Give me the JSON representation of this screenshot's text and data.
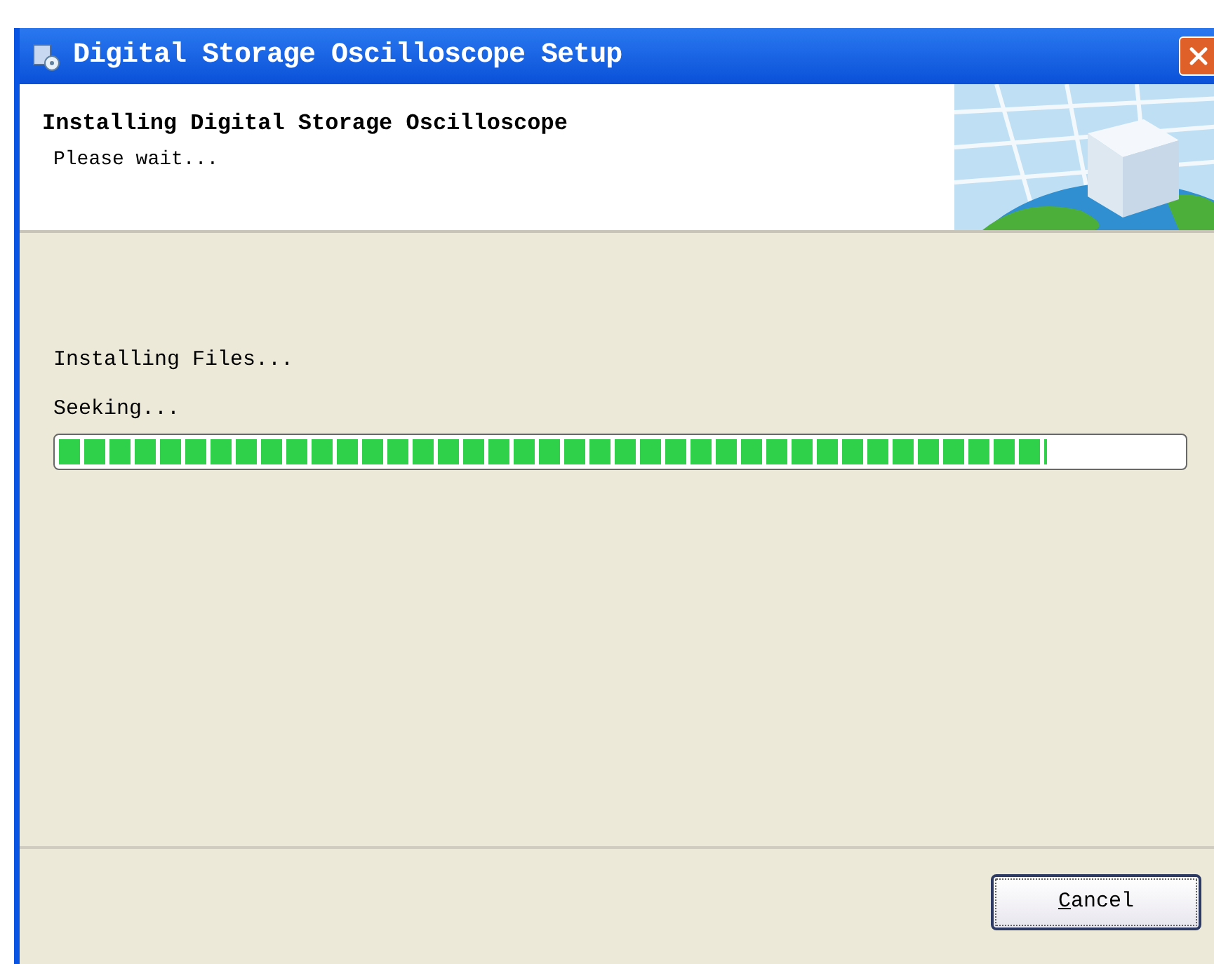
{
  "window": {
    "title": "Digital Storage Oscilloscope Setup"
  },
  "header": {
    "title": "Installing Digital Storage Oscilloscope",
    "subtitle": "Please wait..."
  },
  "status": {
    "action": "Installing Files...",
    "detail": "Seeking..."
  },
  "progress": {
    "level": 0.88
  },
  "buttons": [
    {
      "label": "Cancel"
    }
  ]
}
